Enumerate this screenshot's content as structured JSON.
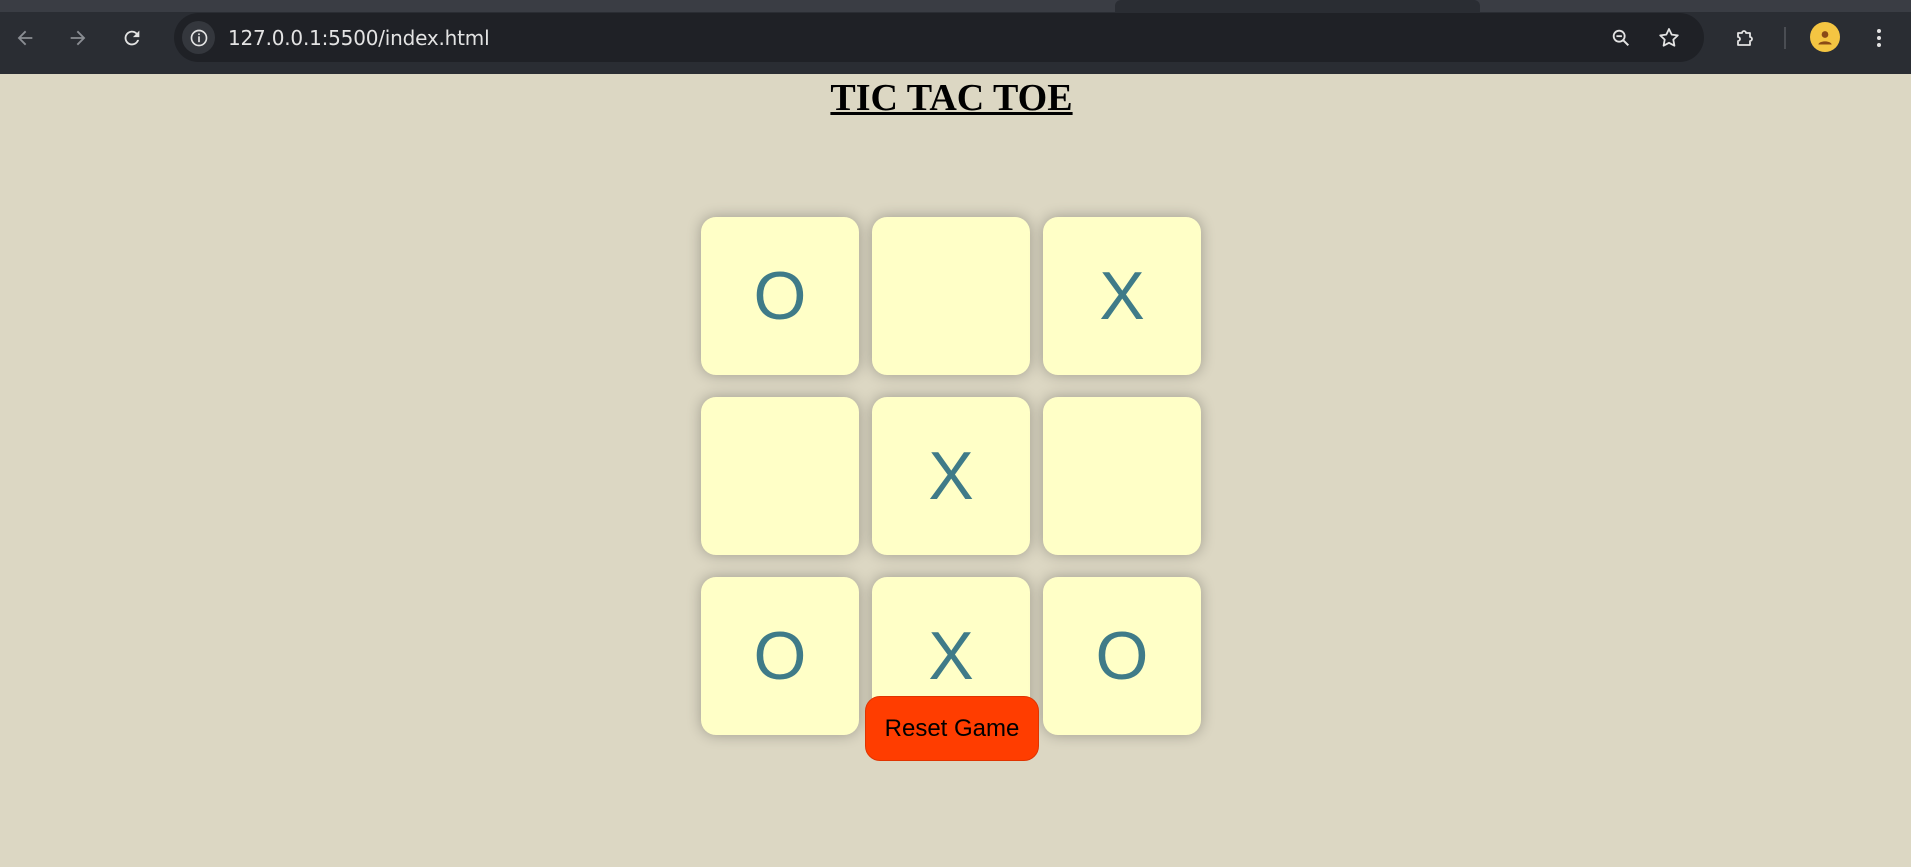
{
  "browser": {
    "url": "127.0.0.1:5500/index.html",
    "icons": {
      "back": "arrow-left-icon",
      "forward": "arrow-right-icon",
      "reload": "reload-icon",
      "site_info": "info-icon",
      "zoom": "zoom-out-icon",
      "bookmark": "star-icon",
      "extensions": "puzzle-icon",
      "menu": "kebab-menu-icon"
    }
  },
  "game": {
    "title": "TIC TAC TOE",
    "cells": [
      "O",
      "",
      "X",
      "",
      "X",
      "",
      "O",
      "X",
      "O"
    ],
    "reset_label": "Reset Game"
  },
  "colors": {
    "page_background": "#dcd7c3",
    "cell_background": "#ffffc7",
    "mark_color": "#3f7b88",
    "reset_button": "#ff3d00"
  }
}
